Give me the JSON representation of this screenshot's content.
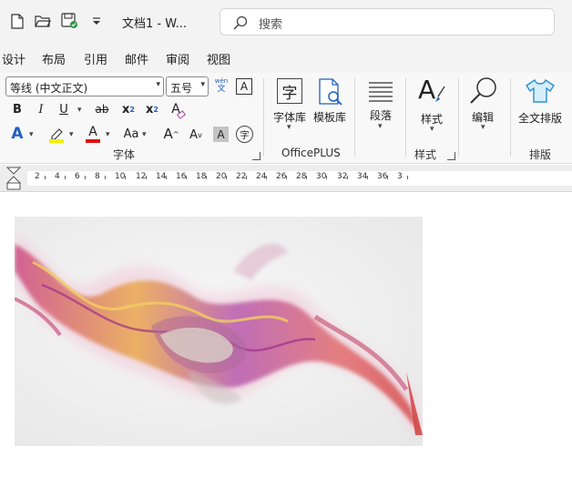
{
  "window": {
    "title": "文档1  -  W..."
  },
  "search": {
    "placeholder": "搜索"
  },
  "quick_access": [
    "new-icon",
    "open-icon",
    "save-icon",
    "customize-icon"
  ],
  "tabs": [
    "设计",
    "布局",
    "引用",
    "邮件",
    "审阅",
    "视图"
  ],
  "ribbon": {
    "font": {
      "name": "等线 (中文正文)",
      "size": "五号",
      "phonetic_top": "wén",
      "phonetic_bottom": "文",
      "border_char": "A",
      "bold": "B",
      "italic": "I",
      "underline": "U",
      "strike": "ab",
      "subscript": "x",
      "subscript_mark": "2",
      "superscript": "x",
      "superscript_mark": "2",
      "clear_format": "A",
      "text_effect": "A",
      "font_color": "A",
      "change_case": "Aa",
      "grow": "A",
      "shrink": "A",
      "char_shading": "A",
      "enclose_char": "字",
      "group_label": "字体",
      "highlight_color": "#f3f000",
      "font_color_value": "#e01010",
      "effect_color": "#1f5fbf"
    },
    "officeplus": {
      "font_lib": "字体库",
      "font_lib_icon_char": "字",
      "template_lib": "模板库",
      "group_label": "OfficePLUS"
    },
    "paragraph": {
      "label": "段落"
    },
    "styles": {
      "icon_char": "A",
      "label": "样式",
      "group_label": "样式"
    },
    "editing": {
      "label": "编辑"
    },
    "layout": {
      "label": "全文排版",
      "group_label": "排版"
    }
  },
  "ruler": {
    "numbers": [
      "2",
      "4",
      "6",
      "8",
      "10",
      "12",
      "14",
      "16",
      "18",
      "20",
      "22",
      "24",
      "26",
      "28",
      "30",
      "32",
      "34",
      "36",
      "3"
    ]
  }
}
